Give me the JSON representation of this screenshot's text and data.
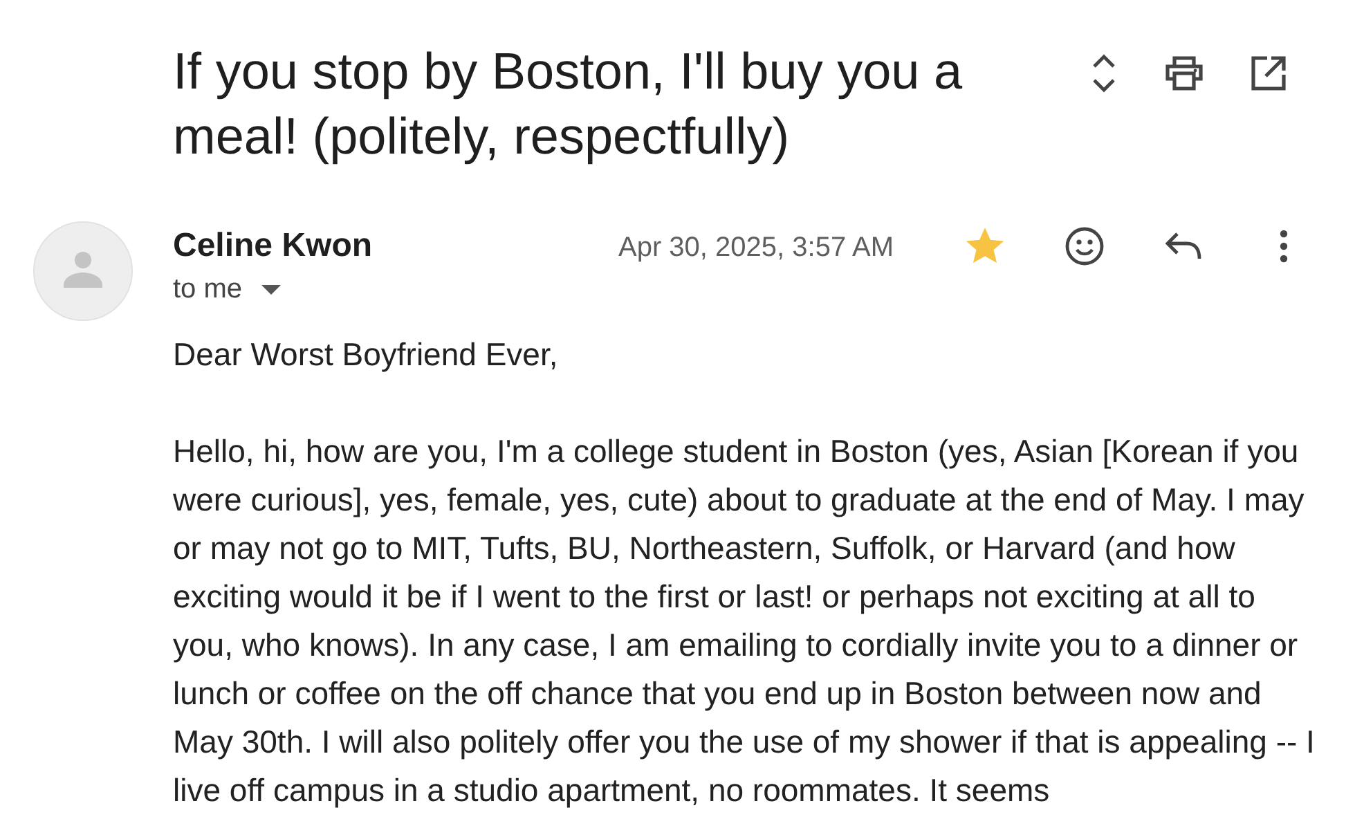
{
  "subject": "If you stop by Boston, I'll buy you a meal! (politely, respectfully)",
  "message": {
    "sender": "Celine Kwon",
    "recipient": "to me",
    "date": "Apr 30, 2025, 3:57 AM",
    "starred": true
  },
  "body": [
    "Dear Worst Boyfriend Ever,",
    "Hello, hi, how are you, I'm a college student in Boston (yes, Asian [Korean if you were curious], yes, female, yes, cute) about to graduate at the end of May. I may or may not go to MIT, Tufts, BU, Northeastern, Suffolk, or Harvard (and how exciting would it be if I went to the first or last! or perhaps not exciting at all to you, who knows). In any case, I am emailing to cordially invite you to a dinner or lunch or coffee on the off chance that you end up in Boston between now and May 30th. I will also politely offer you the use of my shower if that is appealing -- I live off campus in a studio apartment, no roommates. It seems"
  ]
}
